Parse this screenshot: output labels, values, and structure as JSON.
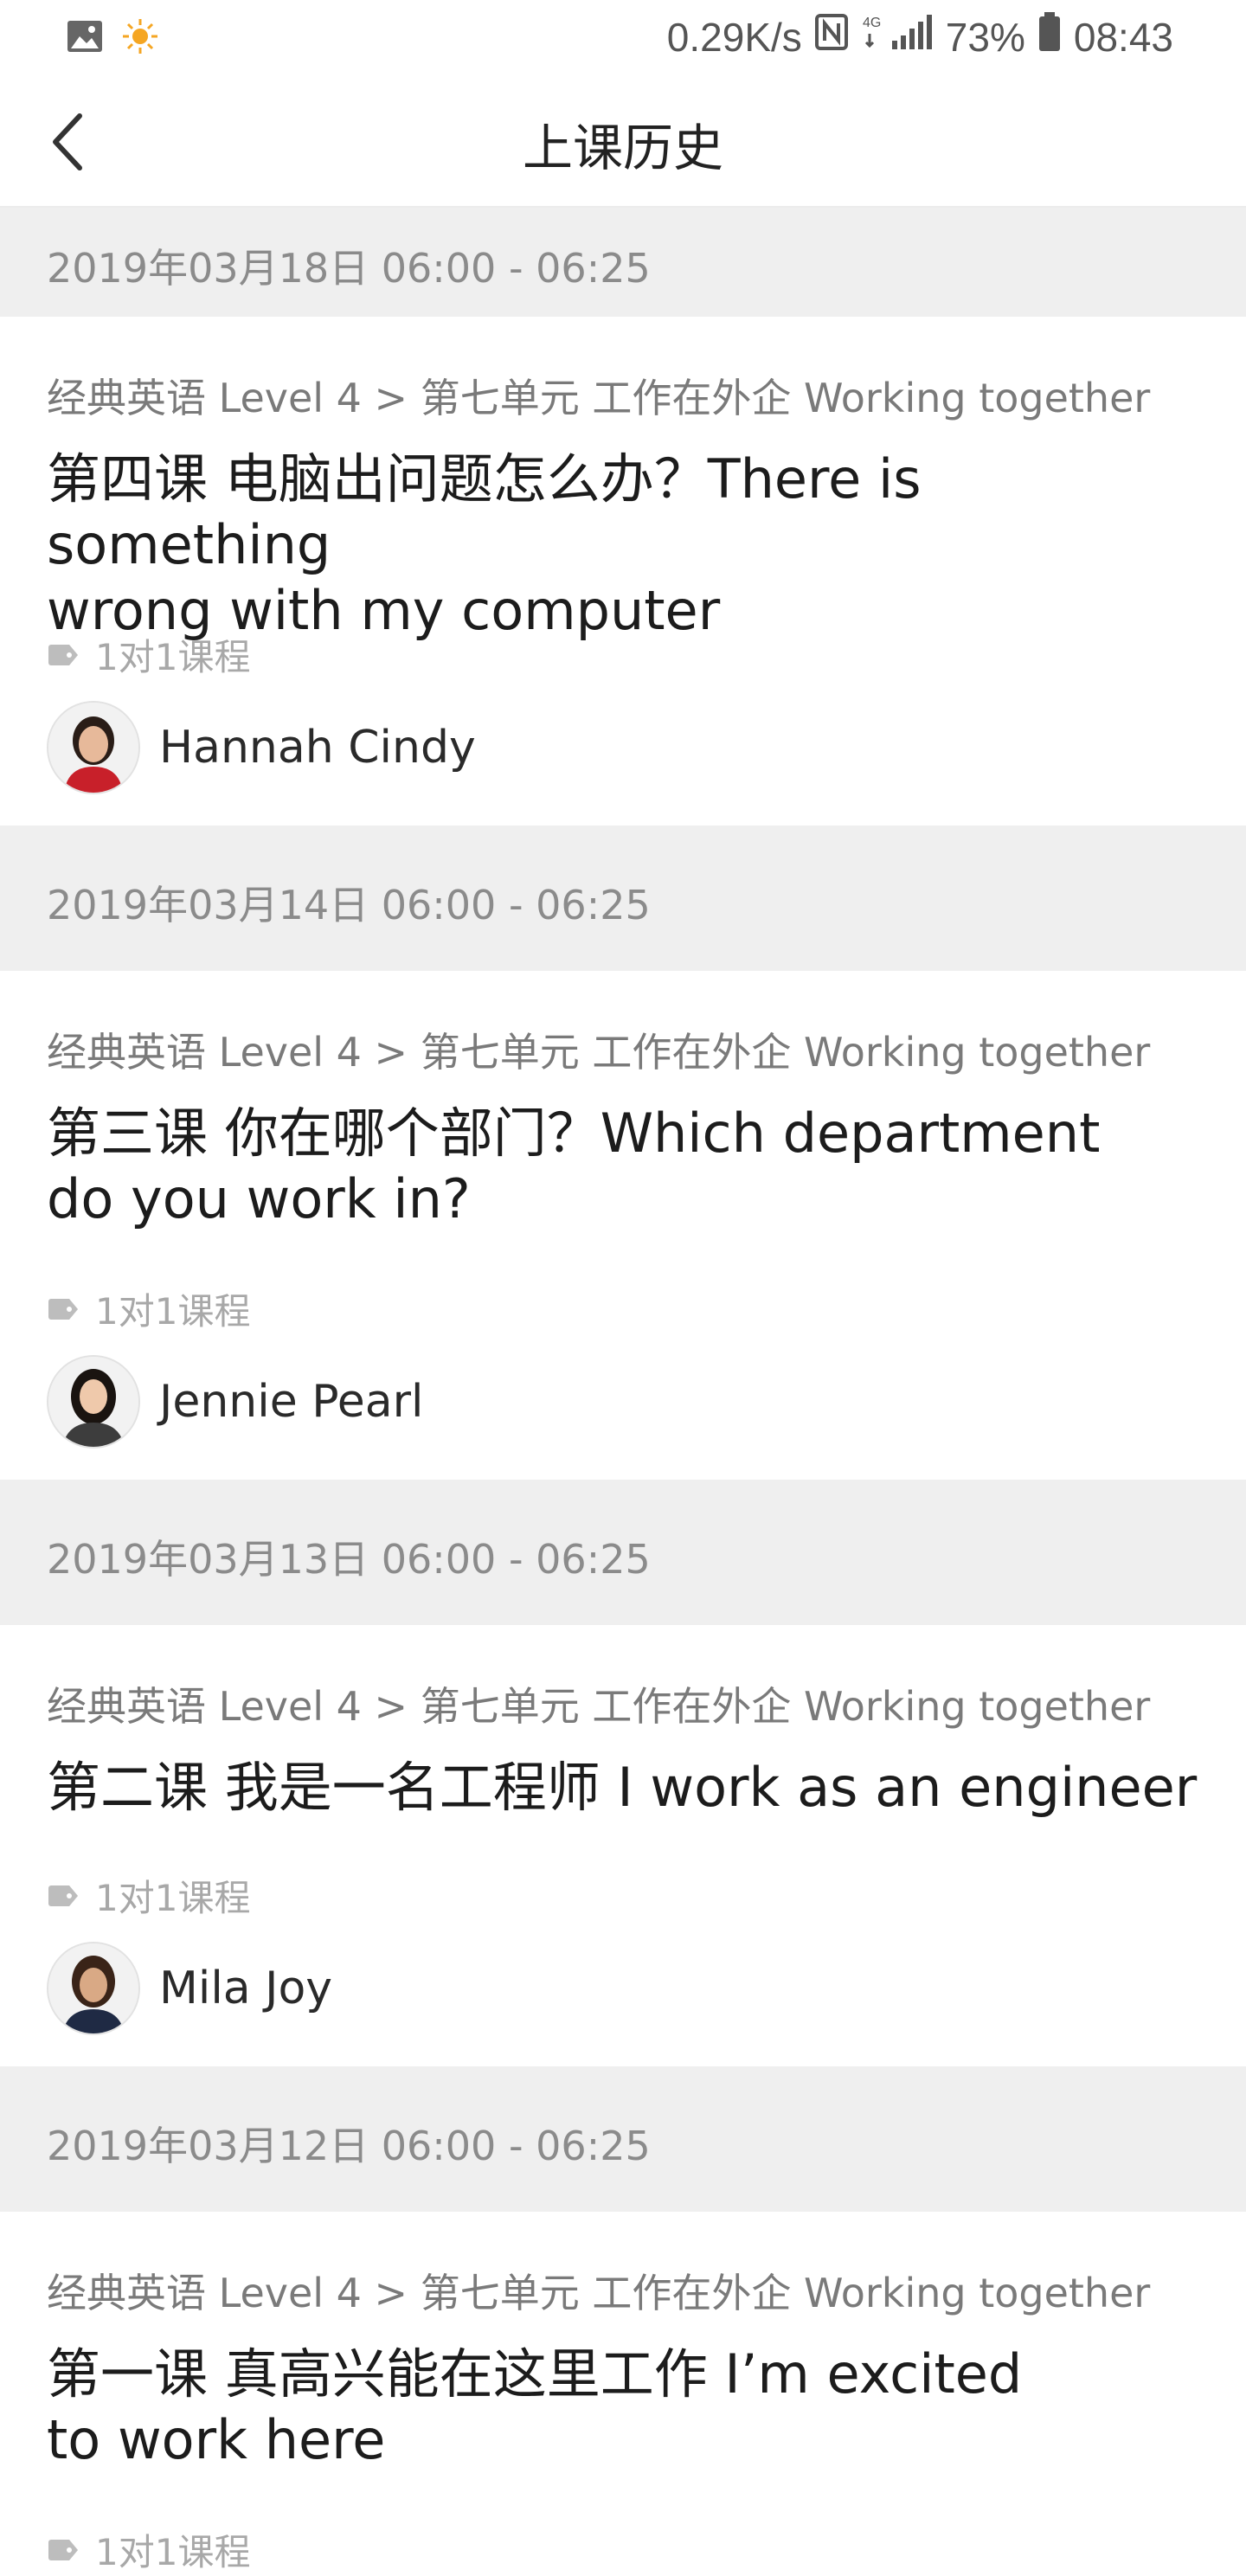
{
  "status_bar": {
    "net_speed": "0.29K/s",
    "network": "4G",
    "battery": "73%",
    "time": "08:43"
  },
  "header": {
    "title": "上课历史"
  },
  "entries": [
    {
      "date": "2019年03月18日 06:00 - 06:25",
      "breadcrumb": "经典英语 Level 4 > 第七单元 工作在外企 Working together",
      "lesson_line1": "第四课 电脑出问题怎么办？There is something",
      "lesson_line2": "wrong with my computer",
      "tag": "1对1课程",
      "teacher": "Hannah Cindy"
    },
    {
      "date": "2019年03月14日 06:00 - 06:25",
      "breadcrumb": "经典英语 Level 4 > 第七单元 工作在外企 Working together",
      "lesson_line1": "第三课 你在哪个部门？Which department",
      "lesson_line2": "do you work in?",
      "tag": "1对1课程",
      "teacher": "Jennie Pearl"
    },
    {
      "date": "2019年03月13日 06:00 - 06:25",
      "breadcrumb": "经典英语 Level 4 > 第七单元 工作在外企 Working together",
      "lesson_line1": "第二课 我是一名工程师 I work as an engineer",
      "lesson_line2": "",
      "tag": "1对1课程",
      "teacher": "Mila Joy"
    },
    {
      "date": "2019年03月12日 06:00 - 06:25",
      "breadcrumb": "经典英语 Level 4 > 第七单元 工作在外企 Working together",
      "lesson_line1": "第一课 真高兴能在这里工作 I’m excited",
      "lesson_line2": "to work here",
      "tag": "1对1课程",
      "teacher": ""
    }
  ],
  "colors": {
    "section_bg": "#efefef",
    "muted_text": "#8b8b8b",
    "tag_gray": "#b5b5b5"
  },
  "icons": [
    "image-icon",
    "brightness-icon",
    "nfc-icon",
    "signal-icon",
    "battery-icon",
    "back-arrow-icon",
    "tag-icon",
    "avatar"
  ]
}
